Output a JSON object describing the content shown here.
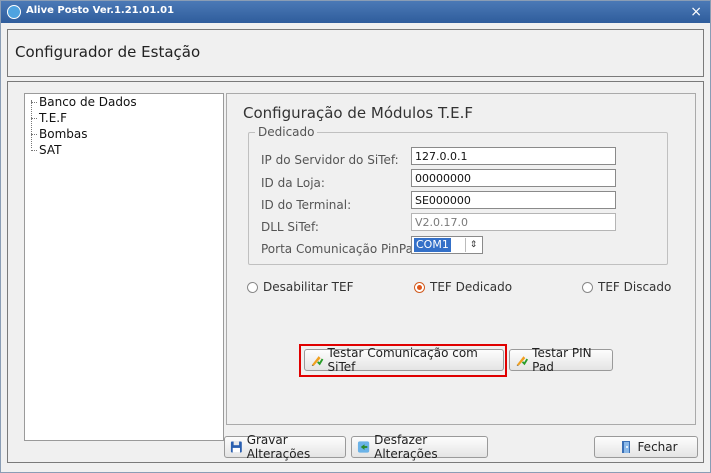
{
  "window": {
    "title": "Alive Posto Ver.1.21.01.01",
    "close_symbol": "×"
  },
  "header": {
    "title": "Configurador de Estação"
  },
  "tree": {
    "items": [
      "Banco de Dados",
      "T.E.F",
      "Bombas",
      "SAT"
    ]
  },
  "tef": {
    "title": "Configuração de Módulos T.E.F",
    "group_label": "Dedicado",
    "fields": [
      {
        "label": "IP do Servidor do SiTef:",
        "value": "127.0.0.1"
      },
      {
        "label": "ID da Loja:",
        "value": "00000000"
      },
      {
        "label": "ID do Terminal:",
        "value": "SE000000"
      },
      {
        "label": "DLL SiTef:",
        "value": "V2.0.17.0"
      }
    ],
    "port": {
      "label": "Porta Comunicação PinPad:",
      "value": "COM1"
    },
    "radios": [
      {
        "label": "Desabilitar TEF",
        "checked": false
      },
      {
        "label": "TEF Dedicado",
        "checked": true
      },
      {
        "label": "TEF Discado",
        "checked": false
      }
    ],
    "buttons": {
      "test_sitef": "Testar Comunicação com SiTef",
      "test_pinpad": "Testar PIN Pad"
    }
  },
  "footer": {
    "save": "Gravar Alterações",
    "undo": "Desfazer Alterações",
    "close": "Fechar"
  },
  "colors": {
    "titlebar": "#2f5d9c",
    "highlight": "#e00000",
    "selected": "#3470c8",
    "radio_checked": "#e0571a"
  },
  "icons": {
    "app": "app-logo-icon",
    "test": "pencil-check-icon",
    "save": "floppy-disk-icon",
    "undo": "undo-icon",
    "close": "door-exit-icon"
  }
}
